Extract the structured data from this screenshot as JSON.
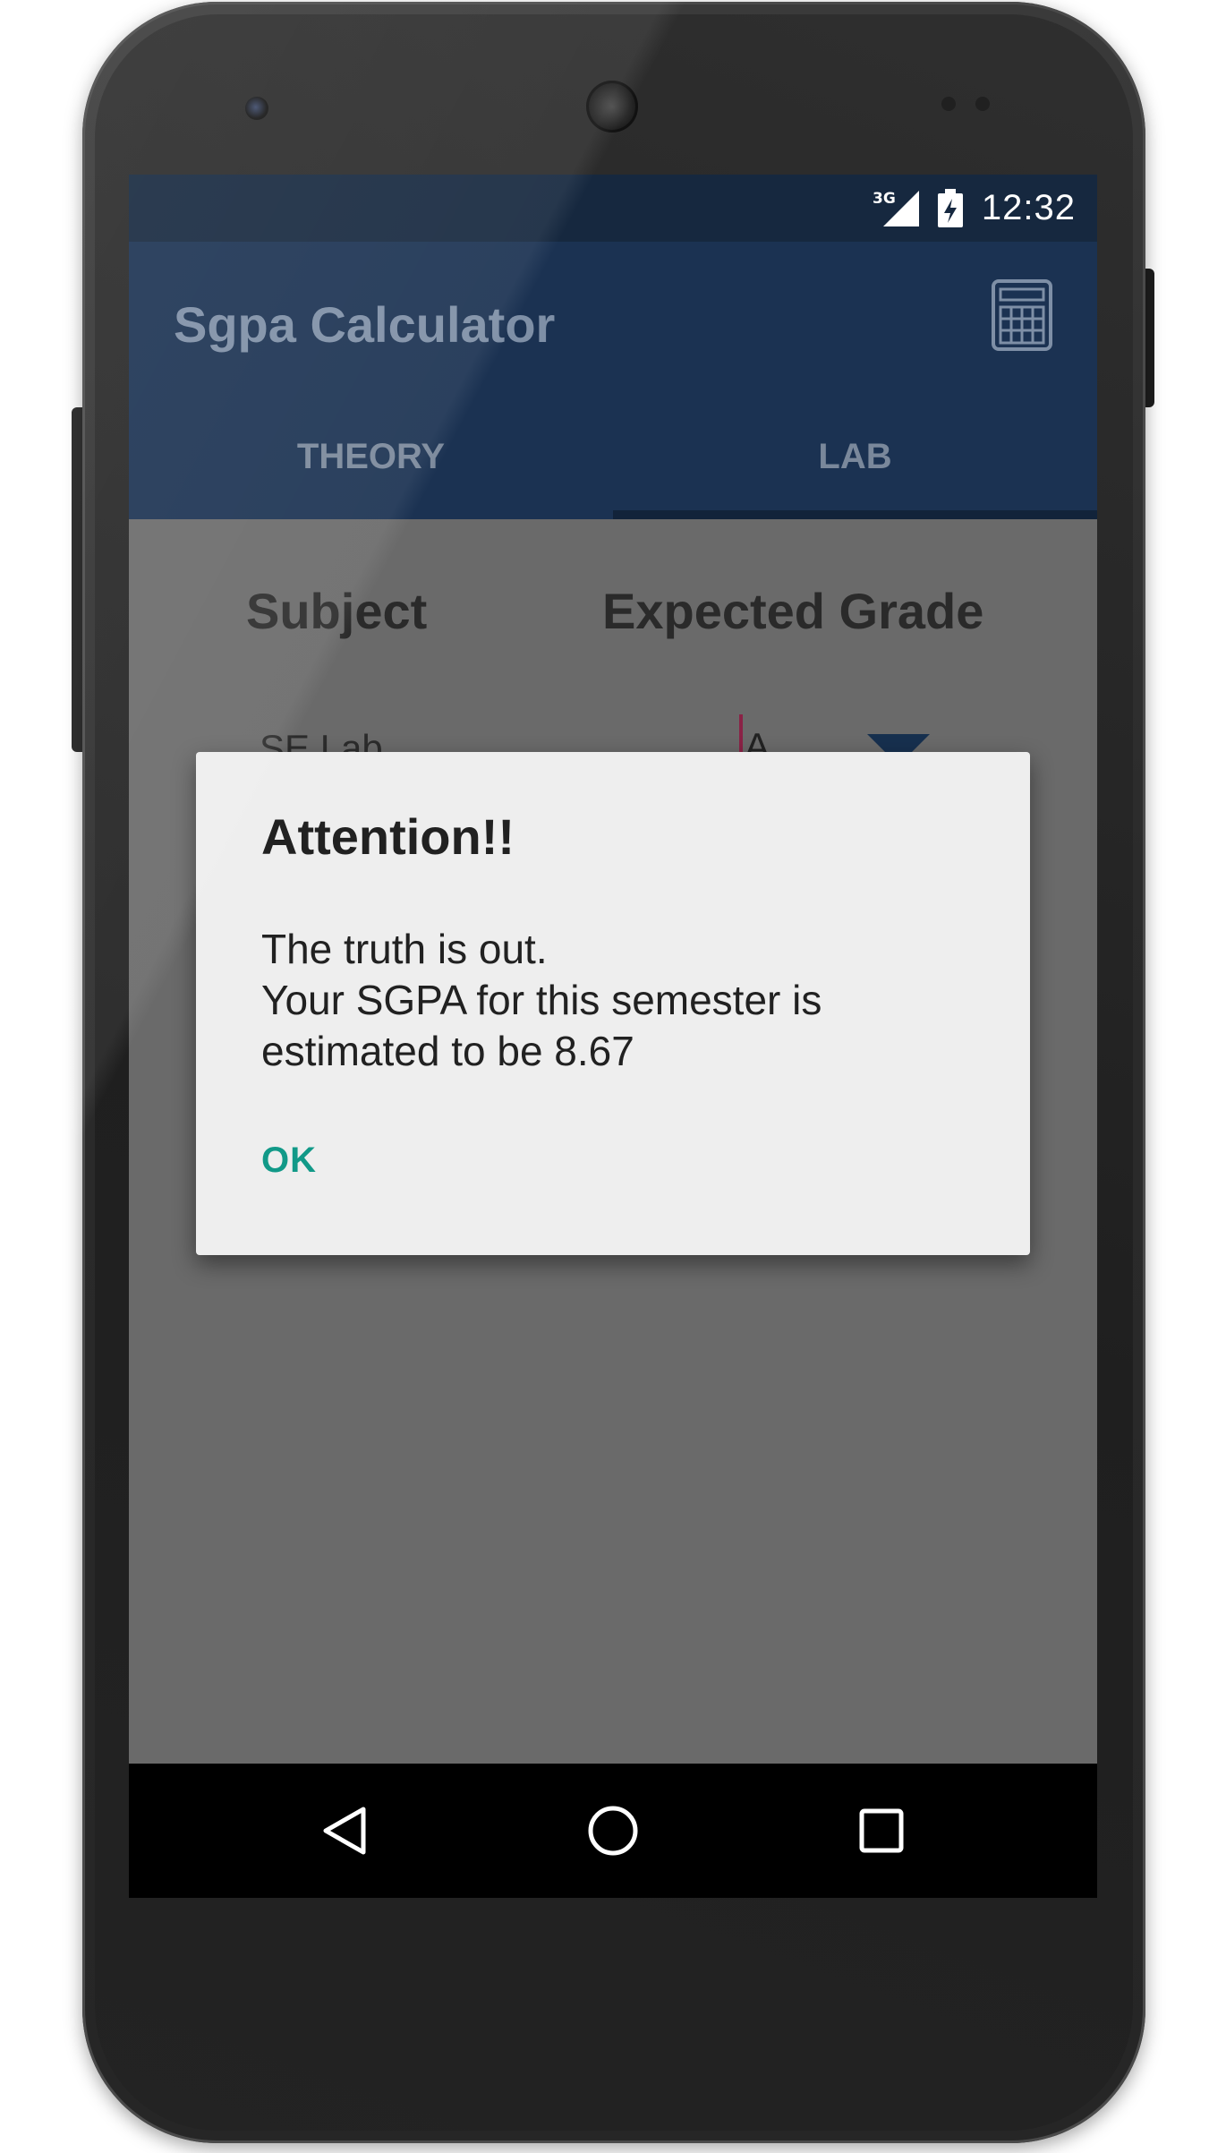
{
  "status_bar": {
    "network": "3G",
    "time": "12:32"
  },
  "app_bar": {
    "title": "Sgpa Calculator",
    "action_icon": "calculator-icon"
  },
  "tabs": [
    {
      "label": "THEORY",
      "selected": false
    },
    {
      "label": "LAB",
      "selected": true
    }
  ],
  "table": {
    "headers": [
      "Subject",
      "Expected Grade"
    ],
    "rows": [
      {
        "subject": "SE Lab",
        "grade": "A"
      }
    ]
  },
  "dialog": {
    "title": "Attention!!",
    "message_lines": [
      "The truth is out.",
      "Your SGPA for this semester is",
      "estimated to be 8.67"
    ],
    "ok_label": "OK"
  },
  "nav_bar": {
    "icons": [
      "back-icon",
      "home-icon",
      "recents-icon"
    ]
  },
  "colors": {
    "primary": "#1b3252",
    "primary_dark": "#16283f",
    "accent": "#119988",
    "dialog_bg": "#eeeeee",
    "scrim": "#6a6a6a"
  }
}
